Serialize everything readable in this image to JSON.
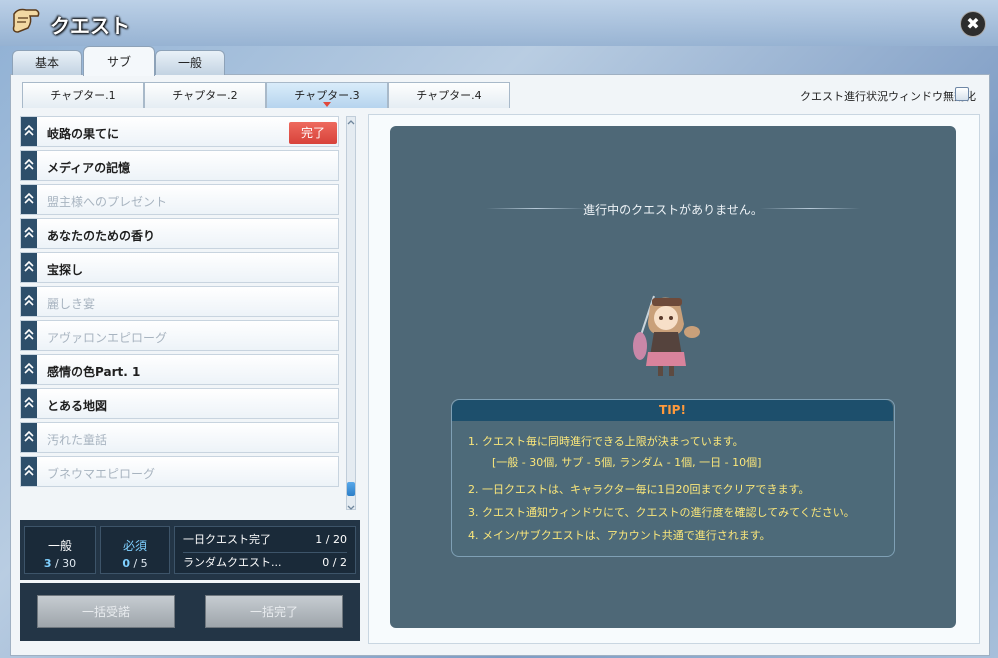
{
  "window": {
    "title": "クエスト",
    "close_label": "✖"
  },
  "main_tabs": [
    {
      "label": "基本"
    },
    {
      "label": "サブ",
      "active": true
    },
    {
      "label": "一般"
    }
  ],
  "chapter_tabs": [
    {
      "label": "チャプター.1"
    },
    {
      "label": "チャプター.2"
    },
    {
      "label": "チャプター.3",
      "active": true
    },
    {
      "label": "チャプター.4"
    }
  ],
  "disable_window": {
    "label": "クエスト進行状況ウィンドウ無効化",
    "checked": false
  },
  "quests": [
    {
      "title": "岐路の果てに",
      "state": "complete",
      "badge": "完了"
    },
    {
      "title": "メディアの記憶",
      "state": "available"
    },
    {
      "title": "盟主様へのプレゼント",
      "state": "dim"
    },
    {
      "title": "あなたのための香り",
      "state": "available"
    },
    {
      "title": "宝探し",
      "state": "available"
    },
    {
      "title": "麗しき宴",
      "state": "dim"
    },
    {
      "title": "アヴァロンエピローグ",
      "state": "dim"
    },
    {
      "title": "感情の色Part. 1",
      "state": "available"
    },
    {
      "title": "とある地図",
      "state": "available"
    },
    {
      "title": "汚れた童話",
      "state": "dim"
    },
    {
      "title": "ブネウマエピローグ",
      "state": "dim"
    }
  ],
  "stats": {
    "general": {
      "label": "一般",
      "current": "3",
      "max": "/ 30"
    },
    "required": {
      "label": "必須",
      "current": "0",
      "max": "/ 5"
    },
    "daily": {
      "label": "一日クエスト完了",
      "count": "1 / 20"
    },
    "random": {
      "label": "ランダムクエスト...",
      "count": "0 / 2"
    }
  },
  "bulk": {
    "accept_label": "一括受諾",
    "complete_label": "一括完了"
  },
  "panel": {
    "no_quest_text": "進行中のクエストがありません。",
    "tip_title": "TIP!",
    "tips": [
      "1. クエスト毎に同時進行できる上限が決まっています。",
      "[一般 - 30個, サブ - 5個, ランダム - 1個, 一日 - 10個]",
      "2. 一日クエストは、キャラクター毎に1日20回までクリアできます。",
      "3. クエスト通知ウィンドウにて、クエストの進行度を確認してみてください。",
      "4. メイン/サブクエストは、アカウント共通で進行されます。"
    ]
  },
  "colors": {
    "accent": "#2d7fc7",
    "complete_badge": "#e05248",
    "panel_bg": "#4e6877",
    "tip_header": "#1d4f6c",
    "tip_text": "#fbe77a"
  },
  "icons": {
    "title": "scroll-icon",
    "close": "close-icon",
    "quest_marker": "chevron-up-icon",
    "character": "character-sprite"
  }
}
